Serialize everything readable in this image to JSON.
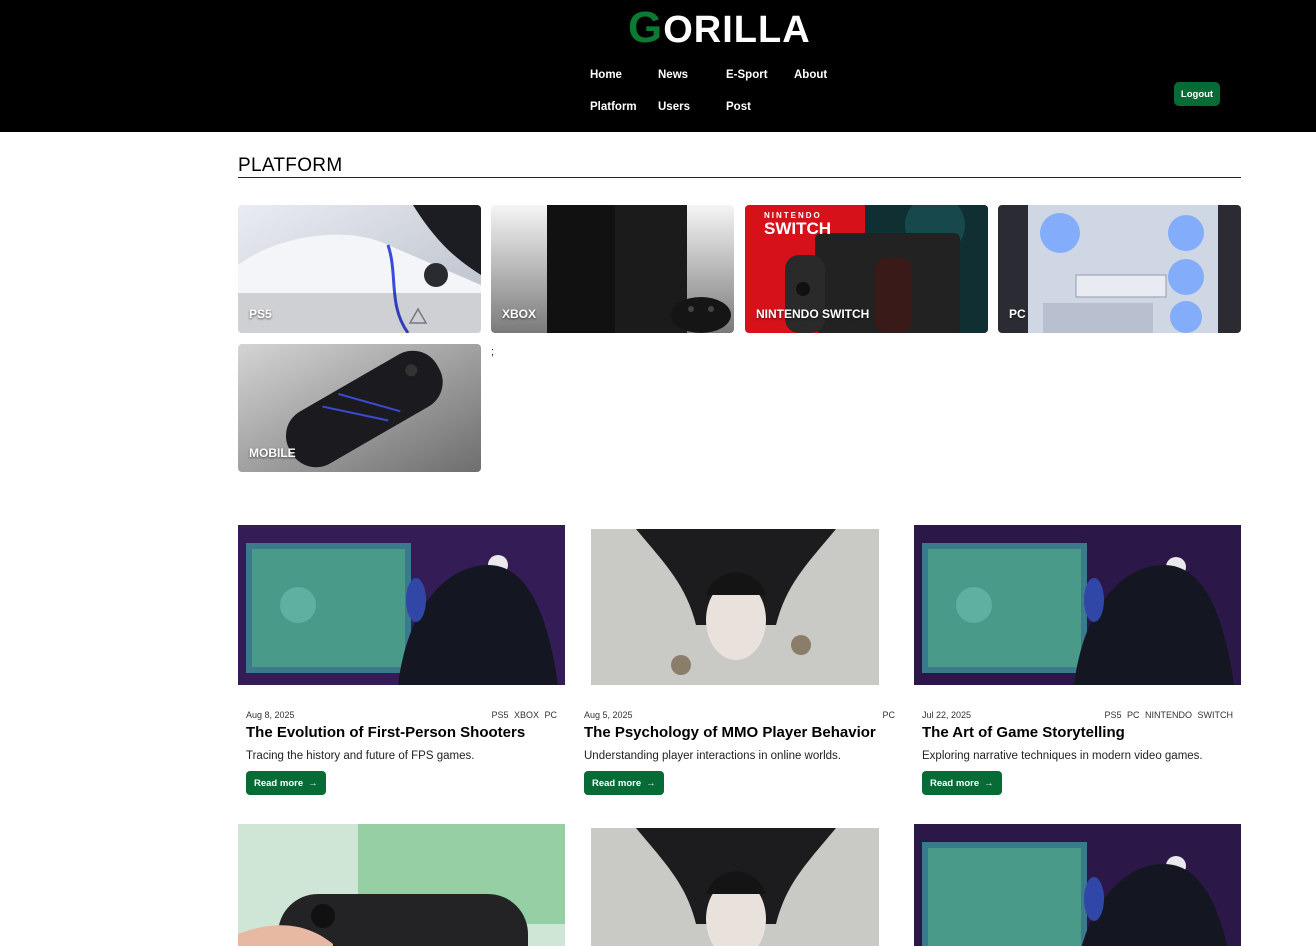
{
  "header": {
    "logo_initial": "G",
    "logo_rest": "ORILLA",
    "nav": [
      {
        "label": "Home"
      },
      {
        "label": "News"
      },
      {
        "label": "E-Sport"
      },
      {
        "label": "About"
      },
      {
        "label": "Platform"
      },
      {
        "label": "Users"
      },
      {
        "label": "Post"
      }
    ],
    "logout_label": "Logout"
  },
  "platform_section": {
    "title": "PLATFORM",
    "cards": [
      {
        "label": "PS5"
      },
      {
        "label": "XBOX"
      },
      {
        "label": "NINTENDO SWITCH"
      },
      {
        "label": "PC"
      },
      {
        "label": "MOBILE"
      }
    ],
    "stray_text": ";",
    "switch_brand_line1": "NINTENDO",
    "switch_brand_line2": "SWITCH"
  },
  "posts": [
    {
      "date": "Aug 8, 2025",
      "tags": "PS5 XBOX PC",
      "title": "The Evolution of First-Person Shooters",
      "desc": "Tracing the history and future of FPS games.",
      "cta": "Read more"
    },
    {
      "date": "Aug 5, 2025",
      "tags": "PC",
      "title": "The Psychology of MMO Player Behavior",
      "desc": "Understanding player interactions in online worlds.",
      "cta": "Read more"
    },
    {
      "date": "Jul 22, 2025",
      "tags": "PS5 PC NINTENDO SWITCH",
      "title": "The Art of Game Storytelling",
      "desc": "Exploring narrative techniques in modern video games.",
      "cta": "Read more"
    }
  ],
  "colors": {
    "brand_green": "#0b7a33",
    "button_green": "#066b34",
    "header_bg": "#000000"
  }
}
